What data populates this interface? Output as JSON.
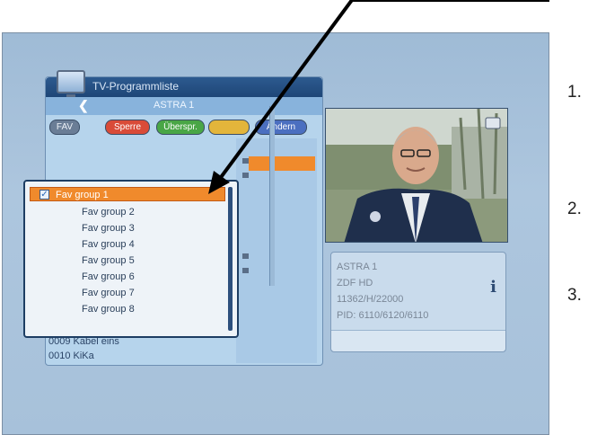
{
  "caption": "",
  "window": {
    "title": "TV-Programmliste",
    "satellite": "ASTRA 1"
  },
  "chips": {
    "fav": "FAV",
    "red": "Sperre",
    "green": "Überspr.",
    "yellow": "",
    "blue": "Ändern"
  },
  "fav_popup": {
    "items": [
      "Fav group 1",
      "Fav group 2",
      "Fav group 3",
      "Fav group 4",
      "Fav group 5",
      "Fav group 6",
      "Fav group 7",
      "Fav group 8"
    ],
    "selected_index": 0
  },
  "channel_list": {
    "rows": [
      "0009 Kabel eins",
      "0010 KiKa"
    ]
  },
  "info": {
    "satellite": "ASTRA 1",
    "channel": "ZDF HD",
    "transponder": "11362/H/22000",
    "pid": "PID: 6110/6120/6110"
  },
  "side_numbers": [
    "1.",
    "2.",
    "3."
  ],
  "colors": {
    "title_bar": "#1e4677",
    "highlight": "#f08a2c",
    "panel": "#b6d4ec"
  }
}
